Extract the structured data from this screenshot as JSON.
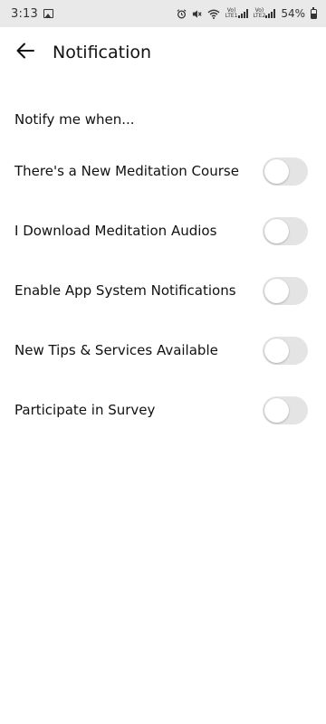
{
  "status_bar": {
    "time": "3:13",
    "left_icons": [
      "gallery-icon"
    ],
    "right_icons": [
      "alarm-icon",
      "mute-icon",
      "wifi-icon",
      "volte-lte1-signal-icon",
      "volte-lte2-signal-icon",
      "battery-icon"
    ],
    "lte1_label_top": "Vo)",
    "lte1_label_bottom": "LTE1",
    "lte2_label_top": "Vo)",
    "lte2_label_bottom": "LTE2",
    "battery": "54%"
  },
  "app_bar": {
    "back_icon": "arrow-left-icon",
    "title": "Notification"
  },
  "section": {
    "heading": "Notify me when..."
  },
  "settings": [
    {
      "label": "There's a New Meditation Course",
      "enabled": false
    },
    {
      "label": "I Download Meditation Audios",
      "enabled": false
    },
    {
      "label": "Enable App System Notifications",
      "enabled": false
    },
    {
      "label": "New Tips & Services Available",
      "enabled": false
    },
    {
      "label": "Participate in Survey",
      "enabled": false
    }
  ],
  "colors": {
    "status_bar_bg": "#e9e9e9",
    "toggle_off_track": "#e4e4e4",
    "toggle_knob": "#ffffff",
    "text": "#111111"
  }
}
